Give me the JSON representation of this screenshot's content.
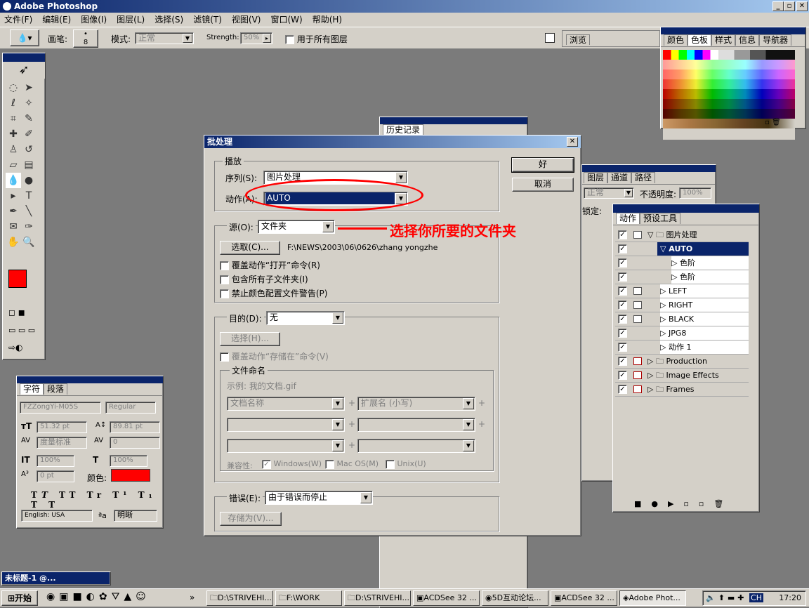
{
  "app": {
    "title": "Adobe Photoshop"
  },
  "menu": [
    "文件(F)",
    "编辑(E)",
    "图像(I)",
    "图层(L)",
    "选择(S)",
    "滤镜(T)",
    "视图(V)",
    "窗口(W)",
    "帮助(H)"
  ],
  "options": {
    "brush_label": "画笔:",
    "brush_size": "8",
    "mode_label": "模式:",
    "mode_value": "正常",
    "strength_label": "Strength:",
    "strength_value": "50%",
    "all_layers": "用于所有图层",
    "browse_tab": "浏览"
  },
  "swatches": {
    "tabs": [
      "颜色",
      "色板",
      "样式",
      "信息",
      "导航器"
    ]
  },
  "history": {
    "tab": "历史记录"
  },
  "layers": {
    "tabs": [
      "图层",
      "通道",
      "路径"
    ],
    "mode": "正常",
    "opacity_label": "不透明度:",
    "opacity_value": "100%",
    "lock_label": "锁定:"
  },
  "actions": {
    "tabs": [
      "动作",
      "预设工具"
    ],
    "items": [
      "图片处理",
      "AUTO",
      "色阶",
      "色阶",
      "LEFT",
      "RIGHT",
      "BLACK",
      "JPG8",
      "动作 1",
      "Production",
      "Image Effects",
      "Frames"
    ]
  },
  "character": {
    "tabs": [
      "字符",
      "段落"
    ],
    "font": "FZZongYi-M05S",
    "style": "Regular",
    "size": "51.32 pt",
    "leading": "89.81 pt",
    "kerning": "度量标准",
    "tracking": "0",
    "vscale": "100%",
    "hscale": "100%",
    "baseline": "0 pt",
    "color_label": "颜色:",
    "language": "English: USA",
    "aa": "明晰"
  },
  "dialog": {
    "title": "批处理",
    "ok": "好",
    "cancel": "取消",
    "play_group": "播放",
    "set_label": "序列(S):",
    "set_value": "图片处理",
    "action_label": "动作(A):",
    "action_value": "AUTO",
    "source_label": "源(O):",
    "source_value": "文件夹",
    "annotation": "选择你所要的文件夹",
    "choose_btn": "选取(C)...",
    "path": "F:\\NEWS\\2003\\06\\0626\\zhang yongzhe",
    "opt1": "覆盖动作“打开”命令(R)",
    "opt2": "包含所有子文件夹(I)",
    "opt3": "禁止颜色配置文件警告(P)",
    "dest_label": "目的(D):",
    "dest_value": "无",
    "dest_choose": "选择(H)...",
    "dest_override": "覆盖动作“存储在”命令(V)",
    "naming_group": "文件命名",
    "example": "示例: 我的文档.gif",
    "doc_name": "文档名称",
    "ext": "扩展名 (小写)",
    "compat_label": "兼容性:",
    "compat_win": "Windows(W)",
    "compat_mac": "Mac OS(M)",
    "compat_unix": "Unix(U)",
    "errors_label": "错误(E):",
    "errors_value": "由于错误而停止",
    "save_as": "存储为(V)..."
  },
  "minimized": {
    "title": "未标题-1 @..."
  },
  "taskbar": {
    "start": "开始",
    "tasks": [
      "D:\\STRIVEHI...",
      "F:\\WORK",
      "D:\\STRIVEHI...",
      "ACDSee 32 ...",
      "5D互动论坛...",
      "ACDSee 32 ...",
      "Adobe Phot..."
    ],
    "lang": "CH",
    "time": "17:20"
  },
  "colors": {
    "accent": "#0a246a",
    "fg_color": "#ff0000",
    "annotation": "#ff0000"
  }
}
